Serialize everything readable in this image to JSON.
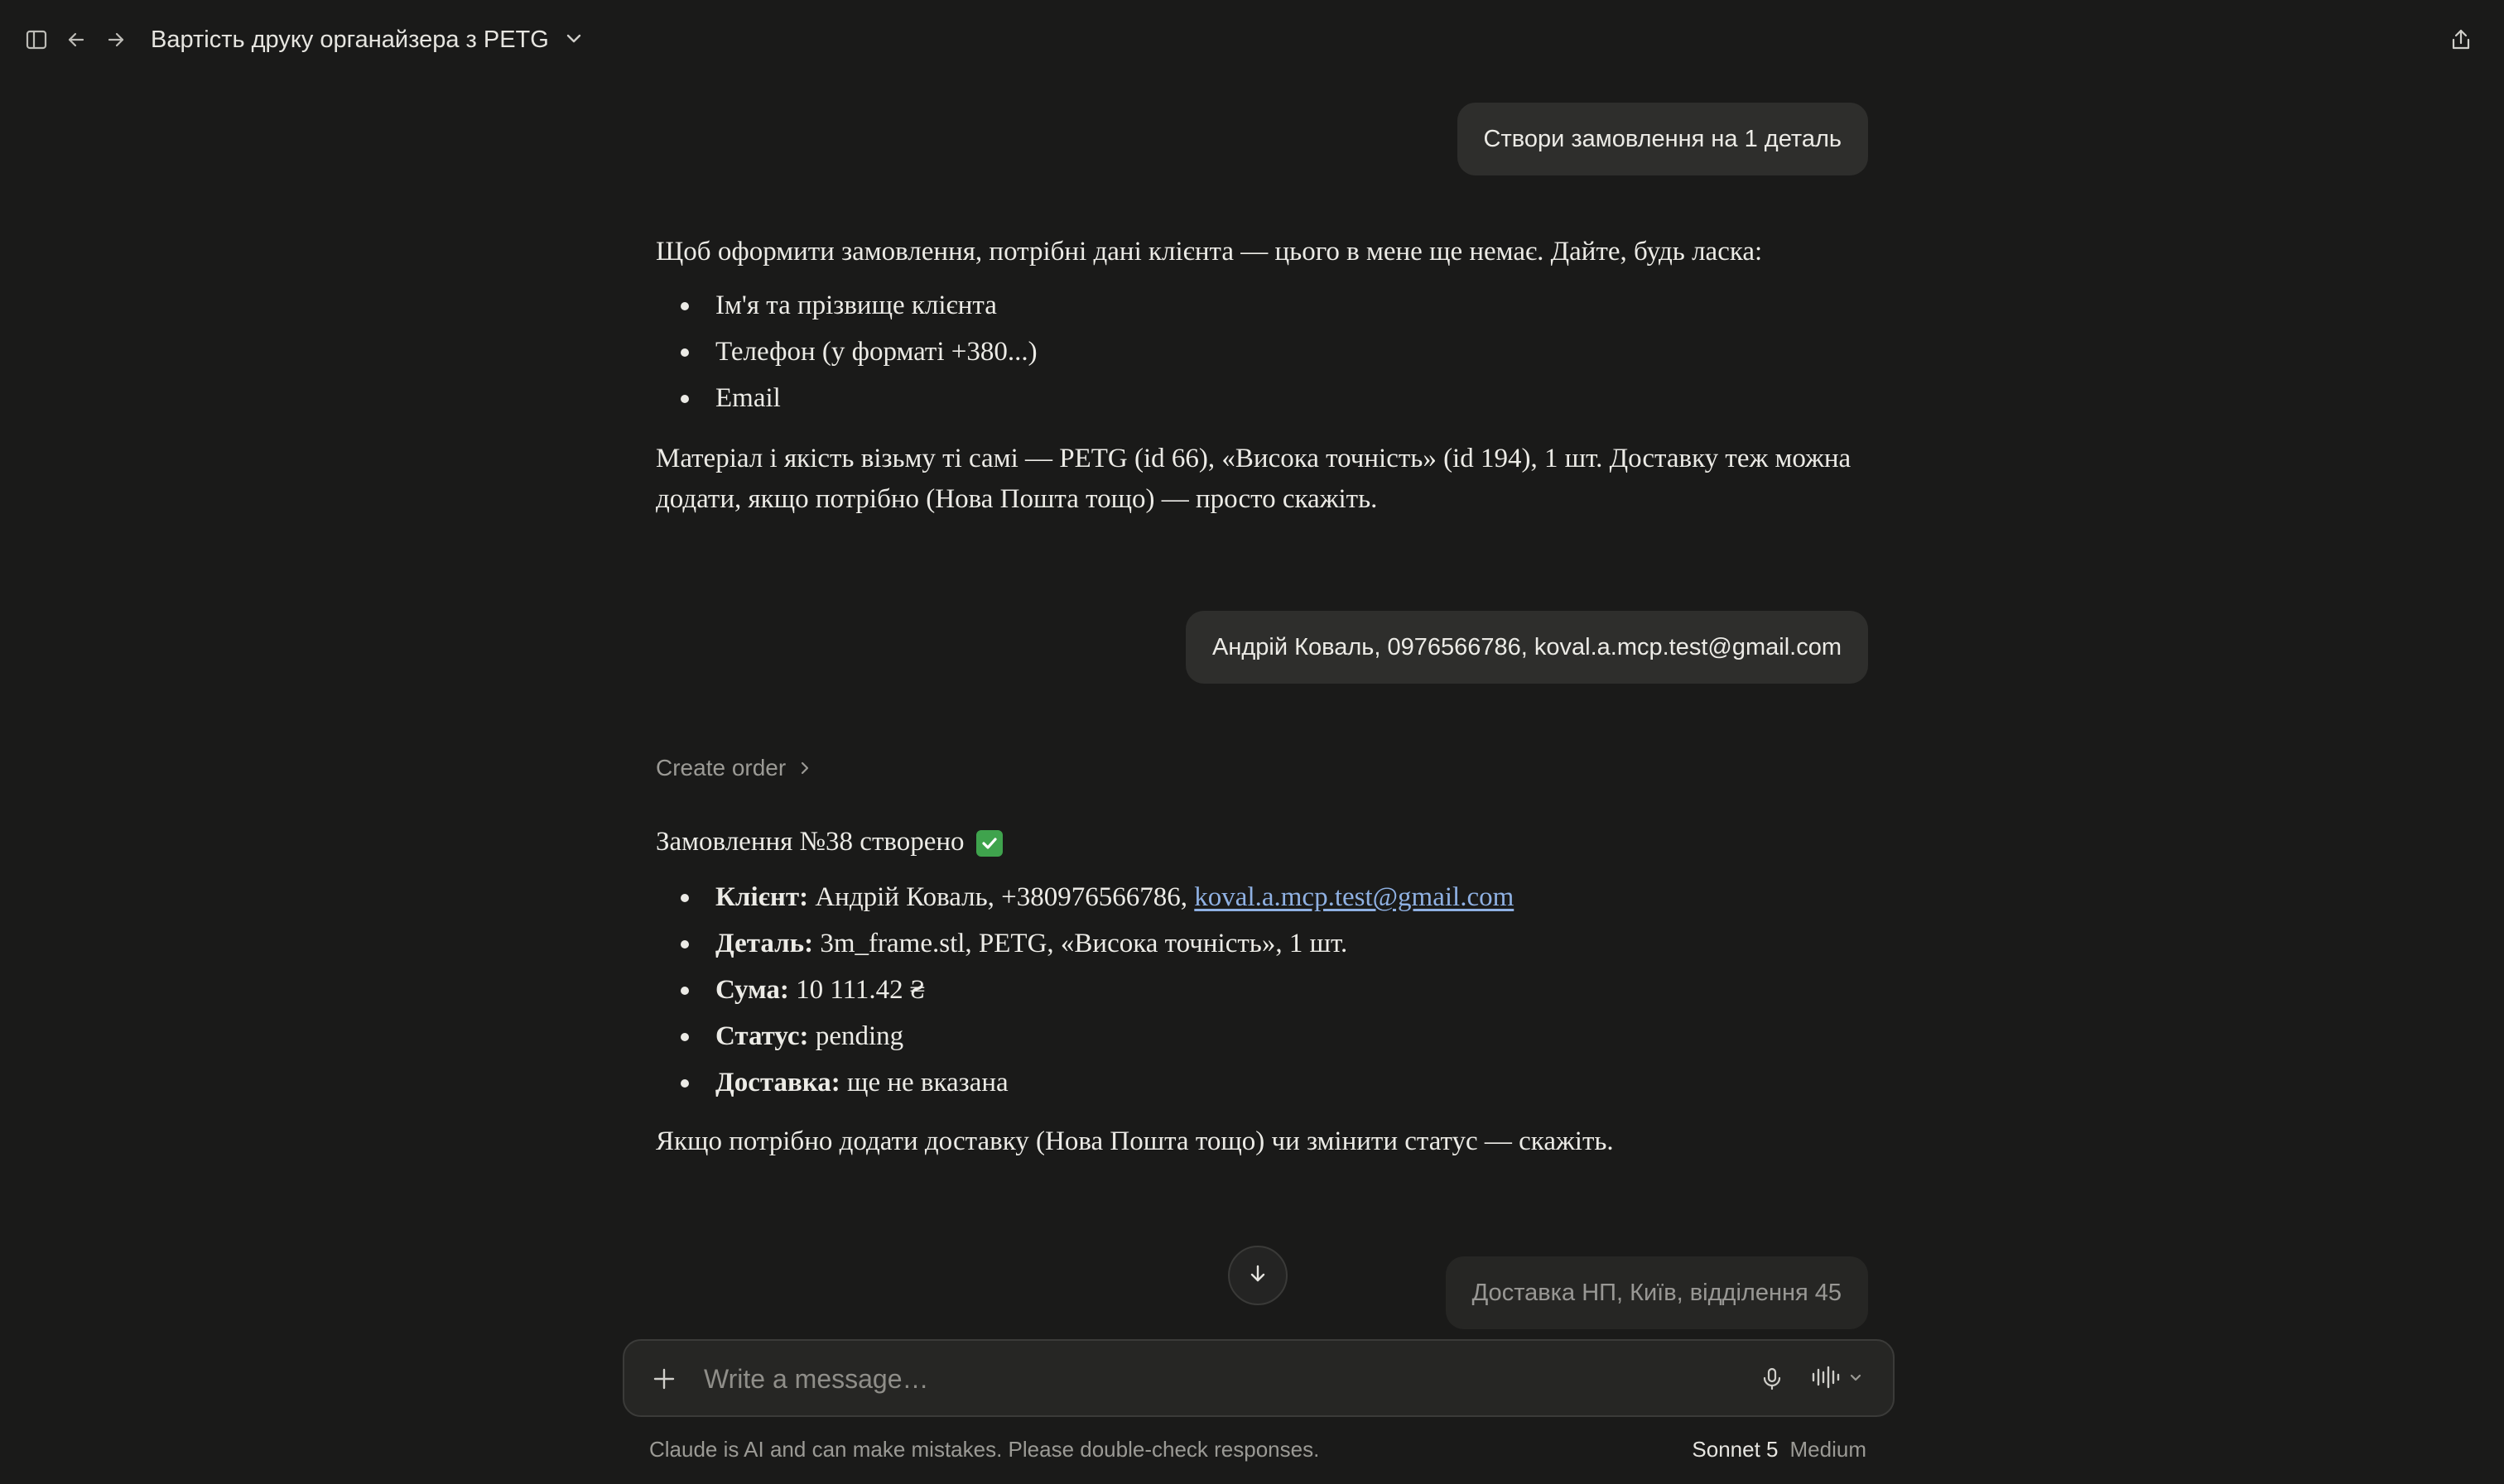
{
  "header": {
    "title": "Вартість друку органайзера з PETG"
  },
  "messages": {
    "user1": "Створи замовлення на 1 деталь",
    "assistant1": {
      "intro": "Щоб оформити замовлення, потрібні дані клієнта — цього в мене ще немає. Дайте, будь ласка:",
      "items": [
        "Ім'я та прізвище клієнта",
        "Телефон (у форматі +380...)",
        "Email"
      ],
      "outro": "Матеріал і якість візьму ті самі — PETG (id 66), «Висока точність» (id 194), 1 шт. Доставку теж можна додати, якщо потрібно (Нова Пошта тощо) — просто скажіть."
    },
    "user2": "Андрій Коваль, 0976566786, koval.a.mcp.test@gmail.com",
    "tool_call": "Create order",
    "assistant2": {
      "heading": "Замовлення №38 створено",
      "client_label": "Клієнт:",
      "client_value": "Андрій Коваль, +380976566786,",
      "client_email": "koval.a.mcp.test@gmail.com",
      "part_label": "Деталь:",
      "part_value": "3m_frame.stl, PETG, «Висока точність», 1 шт.",
      "sum_label": "Сума:",
      "sum_value": "10 111.42 ₴",
      "status_label": "Статус:",
      "status_value": "pending",
      "delivery_label": "Доставка:",
      "delivery_value": "ще не вказана",
      "outro": "Якщо потрібно додати доставку (Нова Пошта тощо) чи змінити статус — скажіть."
    },
    "queued_user": "Доставка НП, Київ, відділення 45"
  },
  "composer": {
    "placeholder": "Write a message…"
  },
  "footer": {
    "disclaimer": "Claude is AI and can make mistakes. Please double-check responses.",
    "model": "Sonnet 5",
    "effort": "Medium"
  },
  "icons": {
    "sidebar": "sidebar-toggle-icon",
    "back": "arrow-left-icon",
    "forward": "arrow-right-icon",
    "title_menu": "chevron-down-icon",
    "share": "share-icon",
    "tool_expand": "chevron-right-icon",
    "check": "check-mark-emoji",
    "scroll": "arrow-down-icon",
    "add": "plus-icon",
    "mic": "microphone-icon",
    "voice": "voice-mode-icon"
  },
  "colors": {
    "background": "#1a1a19",
    "bubble": "#2e2e2c",
    "link": "#8fb1e3",
    "check": "#3fa34d"
  }
}
